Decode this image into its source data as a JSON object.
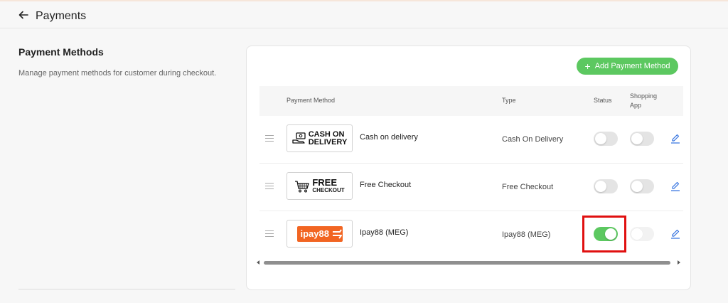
{
  "header": {
    "title": "Payments"
  },
  "section": {
    "title": "Payment Methods",
    "description": "Manage payment methods for customer during checkout."
  },
  "toolbar": {
    "add_label": "Add Payment Method"
  },
  "table": {
    "columns": {
      "method": "Payment Method",
      "type": "Type",
      "status": "Status",
      "shopping_app": "Shopping App"
    },
    "rows": [
      {
        "logo": {
          "line1": "CASH ON",
          "line2": "DELIVERY",
          "icon": "cash-hand-icon"
        },
        "name": "Cash on delivery",
        "type": "Cash On Delivery",
        "status_on": false,
        "shopping_app_on": false
      },
      {
        "logo": {
          "line1": "FREE",
          "line2": "CHECKOUT",
          "icon": "cart-icon"
        },
        "name": "Free Checkout",
        "type": "Free Checkout",
        "status_on": false,
        "shopping_app_on": false
      },
      {
        "logo": {
          "text": "ipay88",
          "color": "#f26522"
        },
        "name": "Ipay88 (MEG)",
        "type": "Ipay88 (MEG)",
        "status_on": true,
        "shopping_app_on": false
      }
    ]
  },
  "colors": {
    "accent": "#5cc860",
    "highlight": "#e01010",
    "edit_icon": "#2f6fde"
  }
}
